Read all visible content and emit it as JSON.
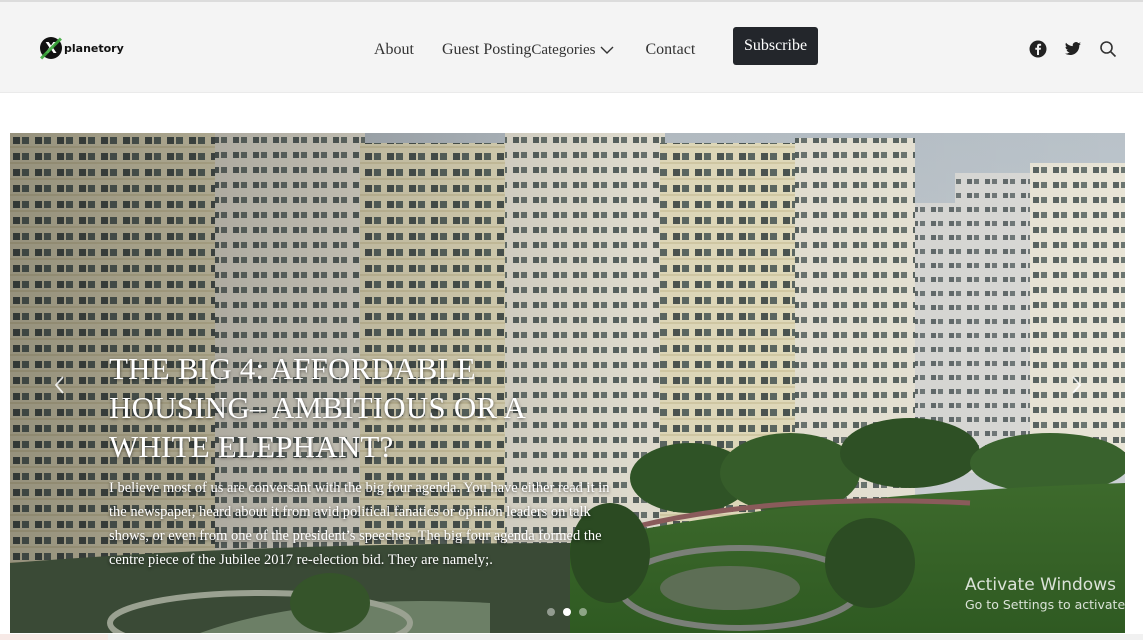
{
  "brand": {
    "logo_letter": "X",
    "name": "planetory"
  },
  "nav": {
    "about": "About",
    "guest_posting": "Guest Posting",
    "categories": "Categories",
    "contact": "Contact",
    "subscribe": "Subscribe"
  },
  "icons": {
    "facebook": "facebook-icon",
    "twitter": "twitter-icon",
    "search": "search-icon",
    "dropdown": "chevron-down-icon",
    "prev": "chevron-left-icon",
    "next": "chevron-right-icon"
  },
  "slider": {
    "title": "THE BIG 4: AFFORDABLE HOUSING– AMBITIOUS OR A WHITE ELEPHANT?",
    "excerpt": "I believe most of us are conversant with the big four agenda. You have either read it in the newspaper, heard about it from avid political fanatics or opinion leaders on talk shows, or even from one of the president’s speeches. The big four agenda formed the centre piece of the Jubilee 2017 re-election bid. They are namely;.",
    "slide_count": 3,
    "active_slide": 2
  },
  "watermark": {
    "line1": "Activate Windows",
    "line2": "Go to Settings to activate Windows."
  },
  "colors": {
    "header_bg": "#f4f4f4",
    "subscribe_bg": "#23262b",
    "caption_text": "#ffffff"
  }
}
